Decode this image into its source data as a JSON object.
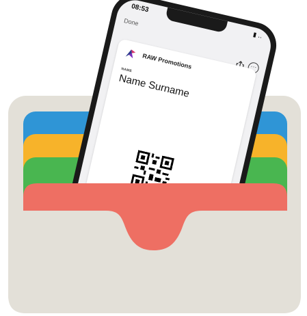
{
  "phone": {
    "time": "08:53",
    "done_label": "Done",
    "status_icons": "▮ ‥"
  },
  "pass": {
    "brand": "RAW Promotions",
    "name_label": "NAME",
    "name_value": "Name Surname"
  },
  "colors": {
    "wallet": "#e3e0d8",
    "blue_card": "#2f95d6",
    "yellow_card": "#f7b32a",
    "green_card": "#49b650",
    "red_card": "#ee6f63",
    "phone_frame": "#1a1a1a"
  },
  "icons": [
    "share-icon",
    "more-icon",
    "raw-logo-icon",
    "qr-code"
  ]
}
